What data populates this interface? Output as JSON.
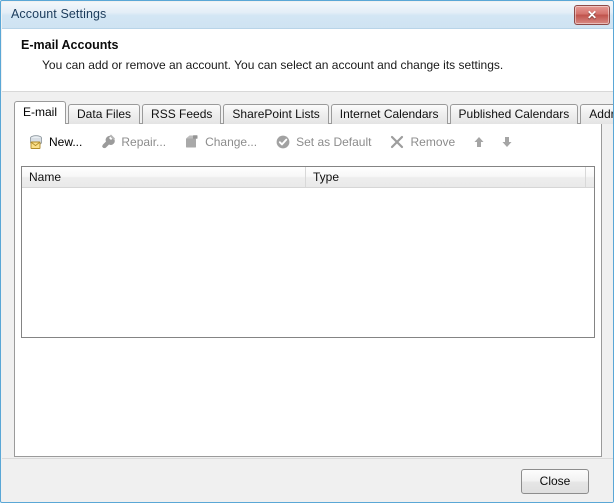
{
  "window": {
    "title": "Account Settings",
    "close_icon_label": "✕",
    "close_icon_name": "window-close-icon"
  },
  "header": {
    "title": "E-mail Accounts",
    "description": "You can add or remove an account. You can select an account and change its settings."
  },
  "tabs": [
    {
      "label": "E-mail",
      "active": true
    },
    {
      "label": "Data Files",
      "active": false
    },
    {
      "label": "RSS Feeds",
      "active": false
    },
    {
      "label": "SharePoint Lists",
      "active": false
    },
    {
      "label": "Internet Calendars",
      "active": false
    },
    {
      "label": "Published Calendars",
      "active": false
    },
    {
      "label": "Address Books",
      "active": false
    }
  ],
  "toolbar": {
    "new_label": "New...",
    "repair_label": "Repair...",
    "change_label": "Change...",
    "set_default_label": "Set as Default",
    "remove_label": "Remove",
    "move_up_label": "",
    "move_down_label": ""
  },
  "list": {
    "columns": [
      "Name",
      "Type",
      ""
    ],
    "rows": []
  },
  "footer": {
    "close_label": "Close"
  },
  "colors": {
    "titlebar_accent": "#cfe3f2",
    "window_border": "#5aa7d6",
    "close_button_red": "#c0534c",
    "disabled_text": "#8c8c8c",
    "body_background": "#f0f0f0"
  }
}
